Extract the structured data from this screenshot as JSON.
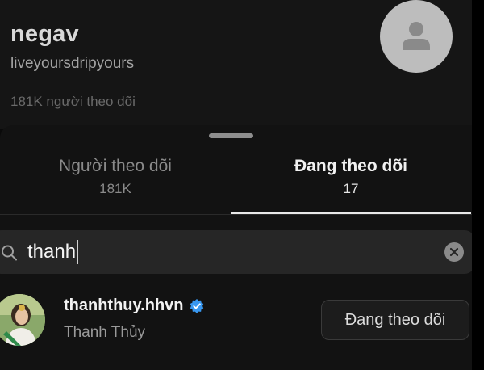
{
  "profile": {
    "username": "negav",
    "full_name": "liveyoursdripyours",
    "followers_text": "181K người theo dõi"
  },
  "tabs": [
    {
      "label": "Người theo dõi",
      "count": "181K",
      "active": false
    },
    {
      "label": "Đang theo dõi",
      "count": "17",
      "active": true
    }
  ],
  "search": {
    "value": "thanh",
    "icon": "search-icon",
    "clear_icon": "clear-icon"
  },
  "results": [
    {
      "username": "thanhthuy.hhvn",
      "verified": true,
      "full_name": "Thanh Thủy",
      "button_label": "Đang theo dõi"
    }
  ],
  "colors": {
    "background": "#0a0a0a",
    "sheet": "#121212",
    "search_field": "#262626",
    "verified": "#3897f0",
    "active_indicator": "#e8e8e8"
  }
}
